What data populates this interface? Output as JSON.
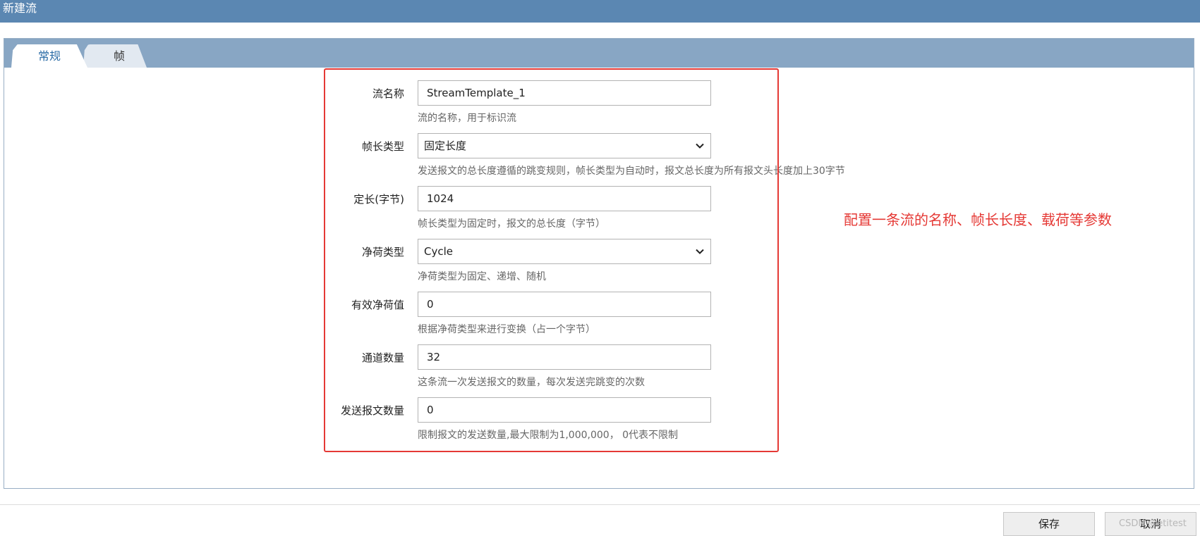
{
  "window": {
    "title": "新建流"
  },
  "tabs": [
    {
      "label": "常规",
      "active": true
    },
    {
      "label": "帧",
      "active": false
    }
  ],
  "form": {
    "stream_name": {
      "label": "流名称",
      "value": "StreamTemplate_1",
      "hint": "流的名称，用于标识流"
    },
    "frame_length_type": {
      "label": "帧长类型",
      "value": "固定长度",
      "hint": "发送报文的总长度遵循的跳变规则，帧长类型为自动时，报文总长度为所有报文头长度加上30字节"
    },
    "fixed_length": {
      "label": "定长(字节)",
      "value": "1024",
      "hint": "帧长类型为固定时，报文的总长度（字节）"
    },
    "payload_type": {
      "label": "净荷类型",
      "value": "Cycle",
      "hint": "净荷类型为固定、递增、随机"
    },
    "valid_payload": {
      "label": "有效净荷值",
      "value": "0",
      "hint": "根据净荷类型来进行变换（占一个字节）"
    },
    "channel_count": {
      "label": "通道数量",
      "value": "32",
      "hint": "这条流一次发送报文的数量，每次发送完跳变的次数"
    },
    "send_count": {
      "label": "发送报文数量",
      "value": "0",
      "hint": "限制报文的发送数量,最大限制为1,000,000， 0代表不限制"
    }
  },
  "annotation": {
    "text": "配置一条流的名称、帧长长度、载荷等参数",
    "color": "#e53935"
  },
  "buttons": {
    "save": "保存",
    "cancel": "取消"
  },
  "watermark": "CSDN @etitest",
  "icons": {
    "dropdown": "chevron-down-icon"
  },
  "colors": {
    "titlebar": "#5b87b2",
    "tabbar": "#88a6c4",
    "active_tab_text": "#2b6ca6"
  }
}
